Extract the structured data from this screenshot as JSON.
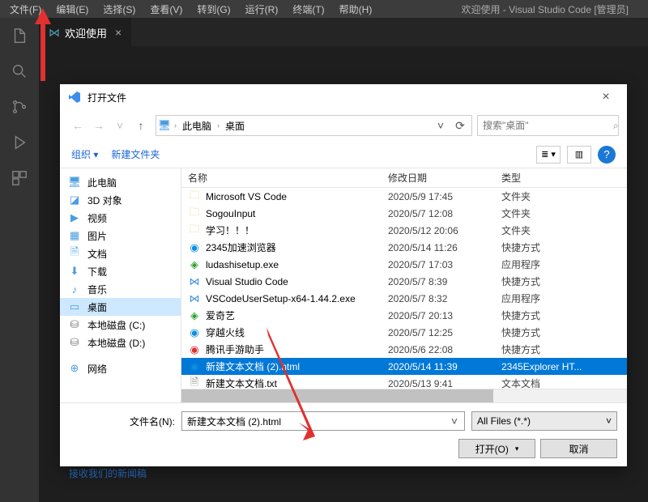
{
  "vsc": {
    "menu": [
      "文件(F)",
      "编辑(E)",
      "选择(S)",
      "查看(V)",
      "转到(G)",
      "运行(R)",
      "终端(T)",
      "帮助(H)"
    ],
    "windowTitle": "欢迎使用 - Visual Studio Code [管理员]",
    "tab": {
      "label": "欢迎使用"
    }
  },
  "bgLink": "接收我们的新闻稿",
  "dialog": {
    "title": "打开文件",
    "path": {
      "root": "此电脑",
      "current": "桌面"
    },
    "searchPlaceholder": "搜索\"桌面\"",
    "toolbar": {
      "organize": "组织",
      "newFolder": "新建文件夹"
    },
    "columns": {
      "name": "名称",
      "date": "修改日期",
      "type": "类型"
    },
    "sidebar": [
      {
        "icon": "pc",
        "label": "此电脑"
      },
      {
        "icon": "3d",
        "label": "3D 对象"
      },
      {
        "icon": "video",
        "label": "视频"
      },
      {
        "icon": "pic",
        "label": "图片"
      },
      {
        "icon": "doc",
        "label": "文档"
      },
      {
        "icon": "dl",
        "label": "下载"
      },
      {
        "icon": "music",
        "label": "音乐"
      },
      {
        "icon": "desk",
        "label": "桌面",
        "sel": true
      },
      {
        "icon": "disk",
        "label": "本地磁盘 (C:)"
      },
      {
        "icon": "disk",
        "label": "本地磁盘 (D:)"
      },
      {
        "gap": true
      },
      {
        "icon": "net",
        "label": "网络"
      }
    ],
    "files": [
      {
        "icon": "folder",
        "name": "Microsoft VS Code",
        "date": "2020/5/9 17:45",
        "type": "文件夹"
      },
      {
        "icon": "folder",
        "name": "SogouInput",
        "date": "2020/5/7 12:08",
        "type": "文件夹"
      },
      {
        "icon": "folder",
        "name": "学习！！！",
        "date": "2020/5/12 20:06",
        "type": "文件夹"
      },
      {
        "icon": "edge",
        "name": "2345加速浏览器",
        "date": "2020/5/14 11:26",
        "type": "快捷方式"
      },
      {
        "icon": "green",
        "name": "ludashisetup.exe",
        "date": "2020/5/7 17:03",
        "type": "应用程序"
      },
      {
        "icon": "vs",
        "name": "Visual Studio Code",
        "date": "2020/5/7 8:39",
        "type": "快捷方式"
      },
      {
        "icon": "vs",
        "name": "VSCodeUserSetup-x64-1.44.2.exe",
        "date": "2020/5/7 8:32",
        "type": "应用程序"
      },
      {
        "icon": "green",
        "name": "爱奇艺",
        "date": "2020/5/7 20:13",
        "type": "快捷方式"
      },
      {
        "icon": "edge",
        "name": "穿越火线",
        "date": "2020/5/7 12:25",
        "type": "快捷方式"
      },
      {
        "icon": "red",
        "name": "腾讯手游助手",
        "date": "2020/5/6 22:08",
        "type": "快捷方式"
      },
      {
        "icon": "edge",
        "name": "新建文本文档 (2).html",
        "date": "2020/5/14 11:39",
        "type": "2345Explorer HT...",
        "sel": true
      },
      {
        "icon": "txt",
        "name": "新建文本文档.txt",
        "date": "2020/5/13 9:41",
        "type": "文本文档"
      }
    ],
    "filenameLabel": "文件名(N):",
    "filenameValue": "新建文本文档 (2).html",
    "filter": "All Files (*.*)",
    "openBtn": "打开(O)",
    "cancelBtn": "取消"
  }
}
